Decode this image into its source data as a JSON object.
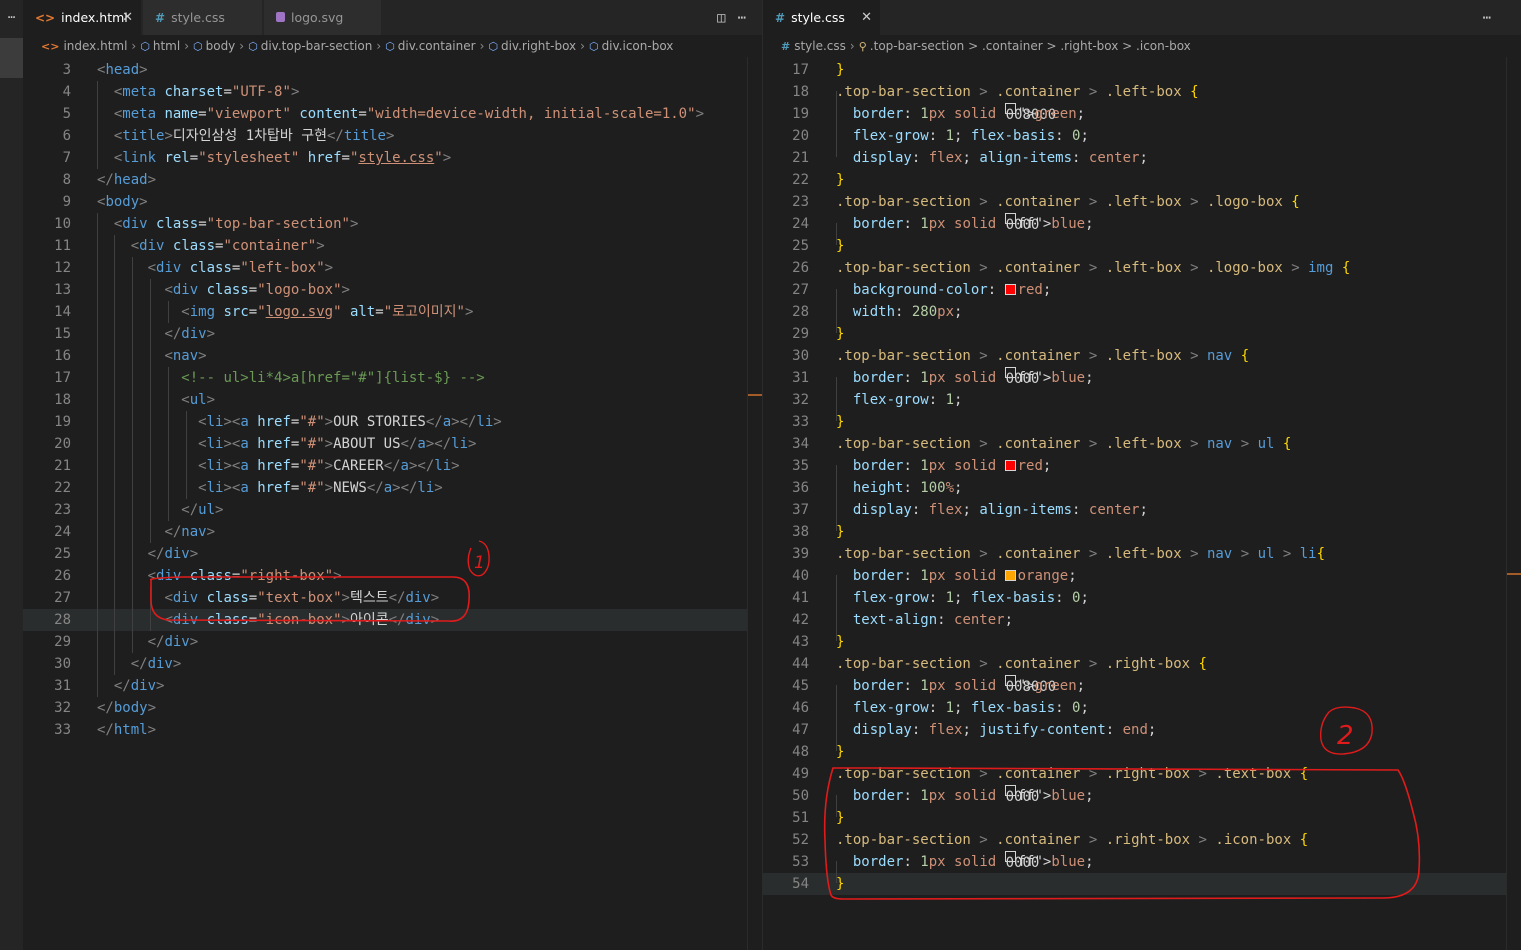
{
  "activity": {
    "menu": "⋯"
  },
  "left": {
    "tabs": [
      {
        "label": "index.html",
        "icon": "<>",
        "close": "✕"
      },
      {
        "label": "style.css",
        "icon": "#"
      },
      {
        "label": "logo.svg"
      }
    ],
    "actions": {
      "split": "◫",
      "more": "⋯"
    },
    "breadcrumb": [
      "index.html",
      "html",
      "body",
      "div.top-bar-section",
      "div.container",
      "div.right-box",
      "div.icon-box"
    ],
    "annotation_label": "1"
  },
  "right": {
    "tabs": [
      {
        "label": "style.css",
        "icon": "#",
        "close": "✕"
      }
    ],
    "actions": {
      "more": "⋯"
    },
    "breadcrumb": [
      "style.css",
      ".top-bar-section > .container > .right-box > .icon-box"
    ],
    "annotation_label": "2"
  },
  "html_lines": [
    {
      "n": "3",
      "code": "<head>"
    },
    {
      "n": "4",
      "code": "  <meta charset=\"UTF-8\">"
    },
    {
      "n": "5",
      "code": "  <meta name=\"viewport\" content=\"width=device-width, initial-scale=1.0\">"
    },
    {
      "n": "6",
      "code": "  <title>디자인삼성 1차탑바 구현</title>"
    },
    {
      "n": "7",
      "code": "  <link rel=\"stylesheet\" href=\"style.css\">"
    },
    {
      "n": "8",
      "code": "</head>"
    },
    {
      "n": "9",
      "code": "<body>"
    },
    {
      "n": "10",
      "code": "  <div class=\"top-bar-section\">"
    },
    {
      "n": "11",
      "code": "    <div class=\"container\">"
    },
    {
      "n": "12",
      "code": "      <div class=\"left-box\">"
    },
    {
      "n": "13",
      "code": "        <div class=\"logo-box\">"
    },
    {
      "n": "14",
      "code": "          <img src=\"logo.svg\" alt=\"로고이미지\">"
    },
    {
      "n": "15",
      "code": "        </div>"
    },
    {
      "n": "16",
      "code": "        <nav>"
    },
    {
      "n": "17",
      "code": "          <!-- ul>li*4>a[href=\"#\"]{list-$} -->"
    },
    {
      "n": "18",
      "code": "          <ul>"
    },
    {
      "n": "19",
      "code": "            <li><a href=\"#\">OUR STORIES</a></li>"
    },
    {
      "n": "20",
      "code": "            <li><a href=\"#\">ABOUT US</a></li>"
    },
    {
      "n": "21",
      "code": "            <li><a href=\"#\">CAREER</a></li>"
    },
    {
      "n": "22",
      "code": "            <li><a href=\"#\">NEWS</a></li>"
    },
    {
      "n": "23",
      "code": "          </ul>"
    },
    {
      "n": "24",
      "code": "        </nav>"
    },
    {
      "n": "25",
      "code": "      </div>"
    },
    {
      "n": "26",
      "code": "      <div class=\"right-box\">"
    },
    {
      "n": "27",
      "code": "        <div class=\"text-box\">텍스트</div>"
    },
    {
      "n": "28",
      "code": "        <div class=\"icon-box\">아이콘</div>"
    },
    {
      "n": "29",
      "code": "      </div>"
    },
    {
      "n": "30",
      "code": "    </div>"
    },
    {
      "n": "31",
      "code": "  </div>"
    },
    {
      "n": "32",
      "code": "</body>"
    },
    {
      "n": "33",
      "code": "</html>"
    }
  ],
  "css_lines": [
    {
      "n": "17",
      "code": "}"
    },
    {
      "n": "18",
      "code": ".top-bar-section > .container > .left-box {"
    },
    {
      "n": "19",
      "code": "  border: 1px solid [green]green;"
    },
    {
      "n": "20",
      "code": "  flex-grow: 1; flex-basis: 0;"
    },
    {
      "n": "21",
      "code": "  display: flex; align-items: center;"
    },
    {
      "n": "22",
      "code": "}"
    },
    {
      "n": "23",
      "code": ".top-bar-section > .container > .left-box > .logo-box {"
    },
    {
      "n": "24",
      "code": "  border: 1px solid [blue]blue;"
    },
    {
      "n": "25",
      "code": "}"
    },
    {
      "n": "26",
      "code": ".top-bar-section > .container > .left-box > .logo-box > img {"
    },
    {
      "n": "27",
      "code": "  background-color: [red]red;"
    },
    {
      "n": "28",
      "code": "  width: 280px;"
    },
    {
      "n": "29",
      "code": "}"
    },
    {
      "n": "30",
      "code": ".top-bar-section > .container > .left-box > nav {"
    },
    {
      "n": "31",
      "code": "  border: 1px solid [blue]blue;"
    },
    {
      "n": "32",
      "code": "  flex-grow: 1;"
    },
    {
      "n": "33",
      "code": "}"
    },
    {
      "n": "34",
      "code": ".top-bar-section > .container > .left-box > nav > ul {"
    },
    {
      "n": "35",
      "code": "  border: 1px solid [red]red;"
    },
    {
      "n": "36",
      "code": "  height: 100%;"
    },
    {
      "n": "37",
      "code": "  display: flex; align-items: center;"
    },
    {
      "n": "38",
      "code": "}"
    },
    {
      "n": "39",
      "code": ".top-bar-section > .container > .left-box > nav > ul > li{"
    },
    {
      "n": "40",
      "code": "  border: 1px solid [orange]orange;"
    },
    {
      "n": "41",
      "code": "  flex-grow: 1; flex-basis: 0;"
    },
    {
      "n": "42",
      "code": "  text-align: center;"
    },
    {
      "n": "43",
      "code": "}"
    },
    {
      "n": "44",
      "code": ".top-bar-section > .container > .right-box {"
    },
    {
      "n": "45",
      "code": "  border: 1px solid [green]green;"
    },
    {
      "n": "46",
      "code": "  flex-grow: 1; flex-basis: 0;"
    },
    {
      "n": "47",
      "code": "  display: flex; justify-content: end;"
    },
    {
      "n": "48",
      "code": "}"
    },
    {
      "n": "49",
      "code": ".top-bar-section > .container > .right-box > .text-box {"
    },
    {
      "n": "50",
      "code": "  border: 1px solid [blue]blue;"
    },
    {
      "n": "51",
      "code": "}"
    },
    {
      "n": "52",
      "code": ".top-bar-section > .container > .right-box > .icon-box {"
    },
    {
      "n": "53",
      "code": "  border: 1px solid [blue]blue;"
    },
    {
      "n": "54",
      "code": "}"
    }
  ],
  "colors": {
    "background": "#1e1e1e",
    "tab_bar": "#252526",
    "annotation_red": "#e01b1b",
    "swatch_green": "#008000",
    "swatch_blue": "#0000ff",
    "swatch_red": "#ff0000",
    "swatch_orange": "#ffa500"
  }
}
